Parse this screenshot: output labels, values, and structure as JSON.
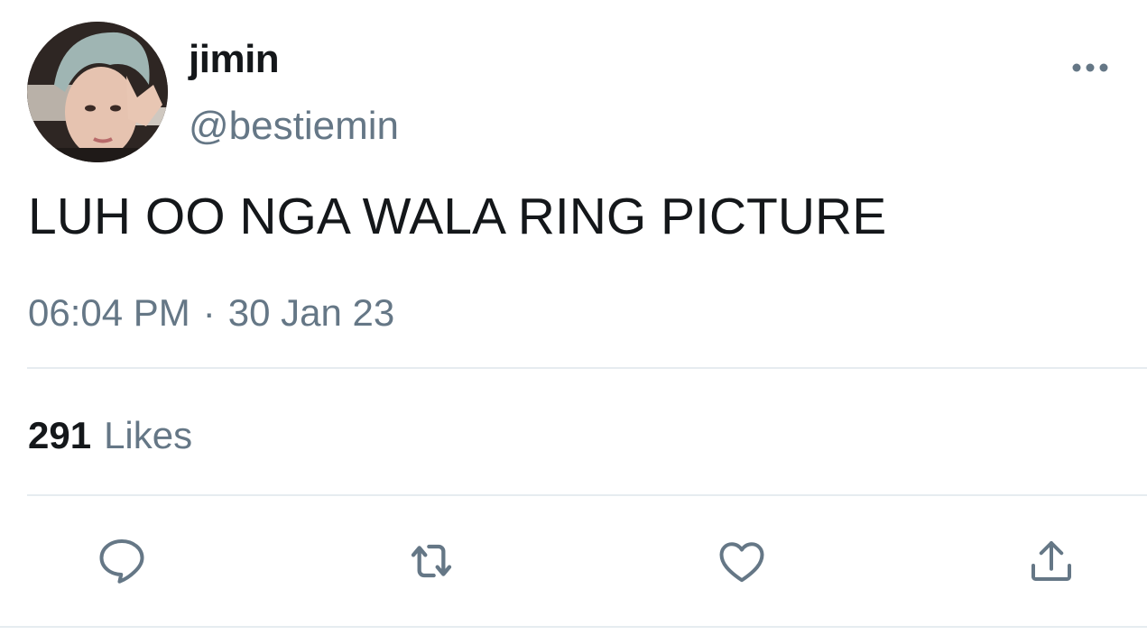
{
  "user": {
    "display_name": "jimin",
    "handle": "@bestiemin"
  },
  "tweet": {
    "text": "LUH OO NGA WALA RING PICTURE",
    "time": "06:04 PM",
    "separator": "·",
    "date": "30 Jan 23"
  },
  "stats": {
    "likes_count": "291",
    "likes_label": "Likes"
  },
  "icons": {
    "more": "more-icon",
    "reply": "reply-icon",
    "retweet": "retweet-icon",
    "like": "heart-icon",
    "share": "share-icon"
  },
  "colors": {
    "text_primary": "#14171a",
    "text_secondary": "#657786",
    "divider": "#e6ecf0",
    "background": "#ffffff"
  }
}
